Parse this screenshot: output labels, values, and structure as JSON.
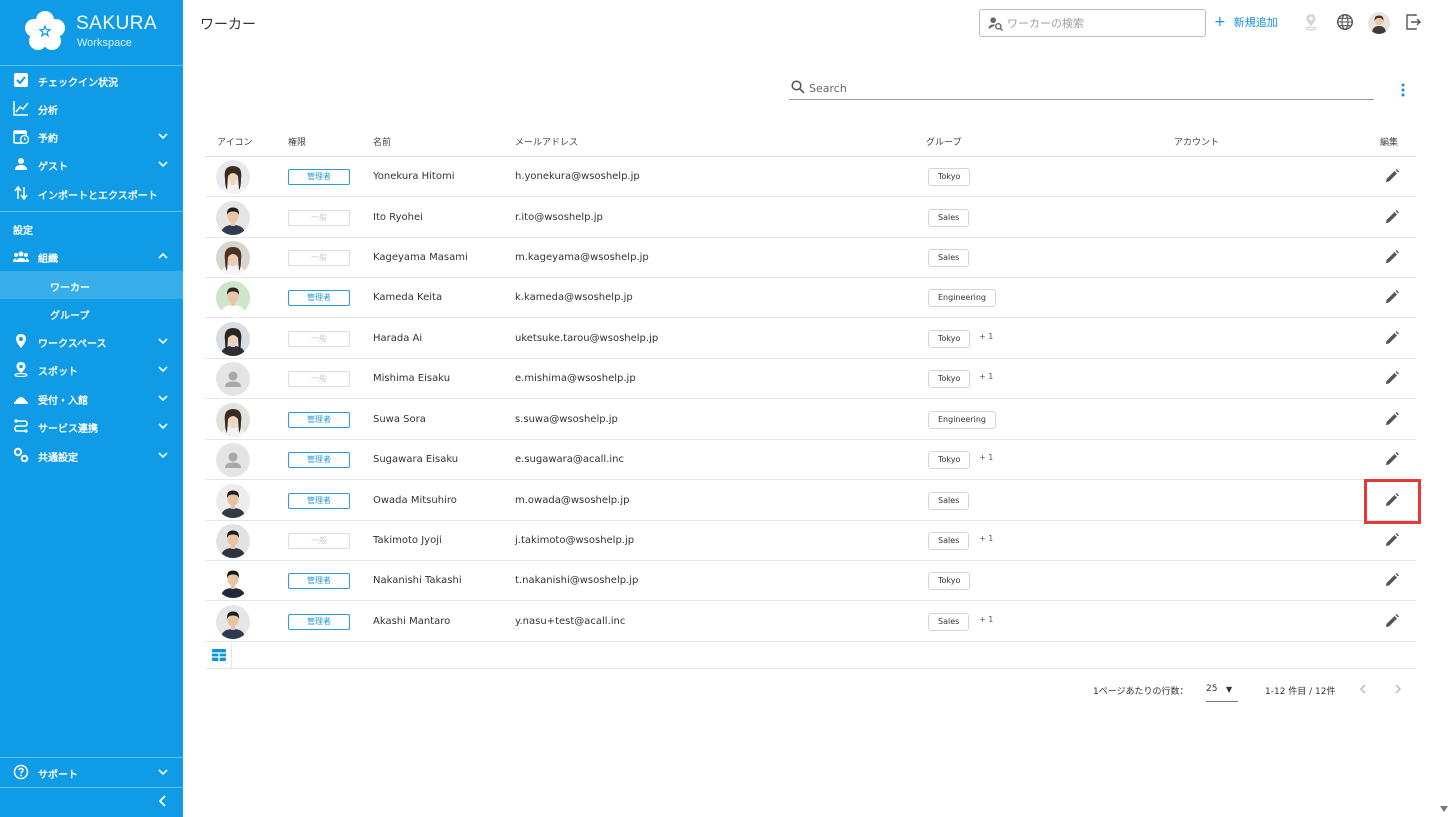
{
  "brand": {
    "name": "SAKURA",
    "sub": "Workspace"
  },
  "sidebar": {
    "items": [
      {
        "label": "チェックイン状況",
        "icon": "checkbox-icon",
        "chevron": false
      },
      {
        "label": "分析",
        "icon": "chart-icon",
        "chevron": false
      },
      {
        "label": "予約",
        "icon": "calendar-icon",
        "chevron": true
      },
      {
        "label": "ゲスト",
        "icon": "guest-icon",
        "chevron": true
      },
      {
        "label": "インポートとエクスポート",
        "icon": "import-export-icon",
        "chevron": false
      }
    ],
    "section_label": "設定",
    "org": {
      "label": "組織",
      "icon": "people-icon",
      "expanded": true
    },
    "org_children": [
      {
        "label": "ワーカー",
        "active": true
      },
      {
        "label": "グループ",
        "active": false
      }
    ],
    "settings_items": [
      {
        "label": "ワークスペース",
        "icon": "location-pin-icon"
      },
      {
        "label": "スポット",
        "icon": "spot-pin-icon"
      },
      {
        "label": "受付・入館",
        "icon": "reception-icon"
      },
      {
        "label": "サービス連携",
        "icon": "service-link-icon"
      },
      {
        "label": "共通設定",
        "icon": "gears-icon"
      }
    ],
    "support": {
      "label": "サポート",
      "icon": "help-icon"
    }
  },
  "header": {
    "title": "ワーカー",
    "search_placeholder": "ワーカーの検索",
    "add_label": "新規追加"
  },
  "table": {
    "search_placeholder": "Search",
    "columns": {
      "icon": "アイコン",
      "role": "権限",
      "name": "名前",
      "email": "メールアドレス",
      "group": "グループ",
      "account": "アカウント",
      "edit": "編集"
    },
    "rows": [
      {
        "avatar": "f1",
        "role": "管理者",
        "role_type": "admin",
        "name": "Yonekura Hitomi",
        "email": "h.yonekura@wsoshelp.jp",
        "group": "Tokyo",
        "extra": ""
      },
      {
        "avatar": "m1",
        "role": "一般",
        "role_type": "general",
        "name": "Ito Ryohei",
        "email": "r.ito@wsoshelp.jp",
        "group": "Sales",
        "extra": ""
      },
      {
        "avatar": "f2",
        "role": "一般",
        "role_type": "general",
        "name": "Kageyama Masami",
        "email": "m.kageyama@wsoshelp.jp",
        "group": "Sales",
        "extra": ""
      },
      {
        "avatar": "m2",
        "role": "管理者",
        "role_type": "admin",
        "name": "Kameda Keita",
        "email": "k.kameda@wsoshelp.jp",
        "group": "Engineering",
        "extra": ""
      },
      {
        "avatar": "f3",
        "role": "一般",
        "role_type": "general",
        "name": "Harada Ai",
        "email": "uketsuke.tarou@wsoshelp.jp",
        "group": "Tokyo",
        "extra": "+ 1"
      },
      {
        "avatar": "placeholder",
        "role": "一般",
        "role_type": "general",
        "name": "Mishima Eisaku",
        "email": "e.mishima@wsoshelp.jp",
        "group": "Tokyo",
        "extra": "+ 1"
      },
      {
        "avatar": "f4",
        "role": "管理者",
        "role_type": "admin",
        "name": "Suwa Sora",
        "email": "s.suwa@wsoshelp.jp",
        "group": "Engineering",
        "extra": ""
      },
      {
        "avatar": "placeholder",
        "role": "管理者",
        "role_type": "admin",
        "name": "Sugawara Eisaku",
        "email": "e.sugawara@acall.inc",
        "group": "Tokyo",
        "extra": "+ 1"
      },
      {
        "avatar": "m3",
        "role": "管理者",
        "role_type": "admin",
        "name": "Owada Mitsuhiro",
        "email": "m.owada@wsoshelp.jp",
        "group": "Sales",
        "extra": ""
      },
      {
        "avatar": "m4",
        "role": "一般",
        "role_type": "general",
        "name": "Takimoto Jyoji",
        "email": "j.takimoto@wsoshelp.jp",
        "group": "Sales",
        "extra": "+ 1"
      },
      {
        "avatar": "m5",
        "role": "管理者",
        "role_type": "admin",
        "name": "Nakanishi Takashi",
        "email": "t.nakanishi@wsoshelp.jp",
        "group": "Tokyo",
        "extra": ""
      },
      {
        "avatar": "m6",
        "role": "管理者",
        "role_type": "admin",
        "name": "Akashi Mantaro",
        "email": "y.nasu+test@acall.inc",
        "group": "Sales",
        "extra": "+ 1"
      }
    ]
  },
  "pager": {
    "rows_per_page_label": "1ページあたりの行数：",
    "rows_per_page": "25",
    "count": "1-12 件目 / 12件"
  },
  "colors": {
    "sidebar": "#0f9be6",
    "accent": "#1292d8",
    "highlight": "#e53935"
  }
}
